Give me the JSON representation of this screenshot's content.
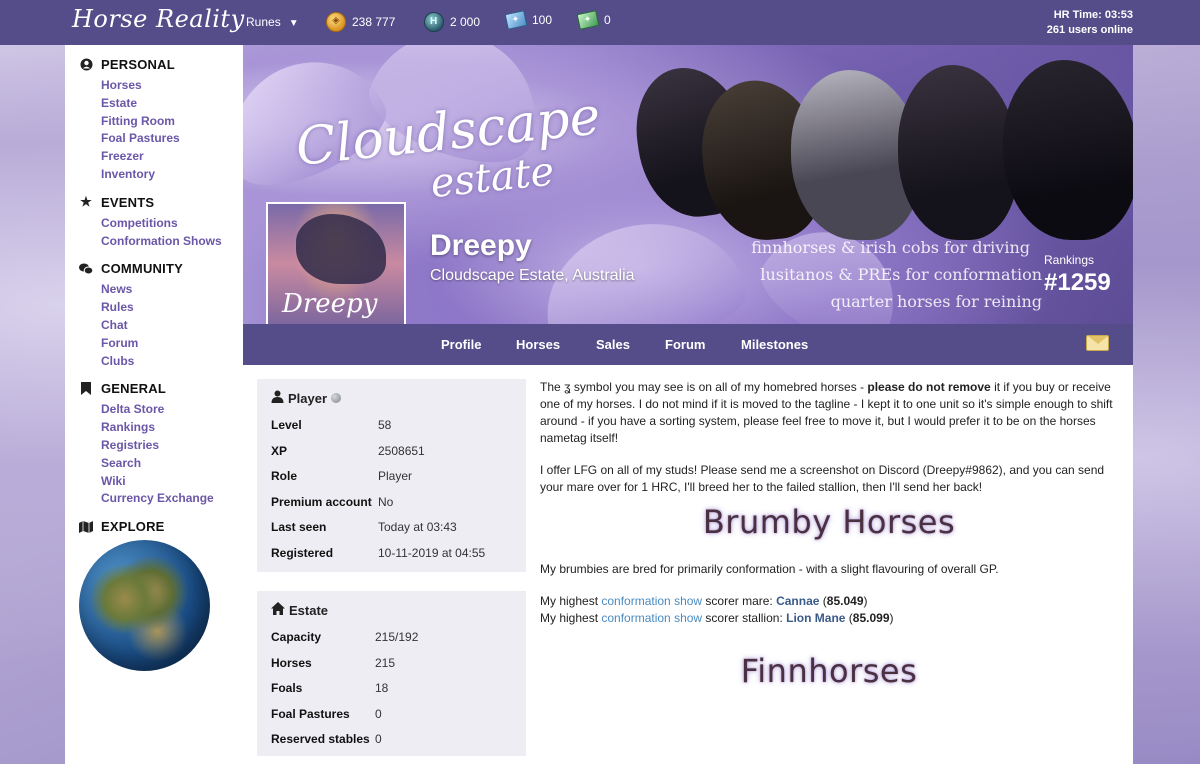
{
  "topbar": {
    "logo": "Horse Reality",
    "runes_label": "Runes",
    "currencies": [
      {
        "icon": "gold-coin-icon",
        "value": "238 777"
      },
      {
        "icon": "horse-coin-icon",
        "value": "2 000"
      },
      {
        "icon": "blue-ticket-icon",
        "value": "100"
      },
      {
        "icon": "green-ticket-icon",
        "value": "0"
      }
    ],
    "hr_time": "HR Time: 03:53",
    "users_online": "261 users online"
  },
  "sidebar": {
    "sections": [
      {
        "title": "PERSONAL",
        "icon": "user-circle-icon",
        "items": [
          "Horses",
          "Estate",
          "Fitting Room",
          "Foal Pastures",
          "Freezer",
          "Inventory"
        ]
      },
      {
        "title": "EVENTS",
        "icon": "star-icon",
        "items": [
          "Competitions",
          "Conformation Shows"
        ]
      },
      {
        "title": "COMMUNITY",
        "icon": "chat-icon",
        "items": [
          "News",
          "Rules",
          "Chat",
          "Forum",
          "Clubs"
        ]
      },
      {
        "title": "GENERAL",
        "icon": "bookmark-icon",
        "items": [
          "Delta Store",
          "Rankings",
          "Registries",
          "Search",
          "Wiki",
          "Currency Exchange"
        ]
      },
      {
        "title": "EXPLORE",
        "icon": "map-icon",
        "items": []
      }
    ]
  },
  "banner": {
    "estate_title_line1": "Cloudscape",
    "estate_title_line2": "estate",
    "avatar_signature": "Dreepy",
    "username": "Dreepy",
    "location": "Cloudscape Estate, Australia",
    "tagline": [
      "finnhorses & irish cobs for driving",
      "lusitanos & PREs for conformation",
      "quarter horses for reining"
    ],
    "rankings_label": "Rankings",
    "rankings_value": "#1259"
  },
  "nav": {
    "tabs": [
      "Profile",
      "Horses",
      "Sales",
      "Forum",
      "Milestones"
    ]
  },
  "player": {
    "title": "Player",
    "rows": [
      {
        "k": "Level",
        "v": "58"
      },
      {
        "k": "XP",
        "v": "2508651"
      },
      {
        "k": "Role",
        "v": "Player"
      },
      {
        "k": "Premium account",
        "v": "No"
      },
      {
        "k": "Last seen",
        "v": "Today at 03:43"
      },
      {
        "k": "Registered",
        "v": "10-11-2019 at 04:55"
      }
    ]
  },
  "estate": {
    "title": "Estate",
    "rows": [
      {
        "k": "Capacity",
        "v": "215/192"
      },
      {
        "k": "Horses",
        "v": "215"
      },
      {
        "k": "Foals",
        "v": "18"
      },
      {
        "k": "Foal Pastures",
        "v": "0"
      },
      {
        "k": "Reserved stables",
        "v": "0"
      }
    ]
  },
  "content": {
    "p1_a": "The ",
    "p1_symbol": "ʓ",
    "p1_b": " symbol you may see is on all of my homebred horses - ",
    "p1_bold": "please do not remove",
    "p1_c": " it if you buy or receive one of my horses. I do not mind if it is moved to the tagline - I kept it to one unit so it's simple enough to shift around - if you have a sorting system, please feel free to move it, but I would prefer it to be on the horses nametag itself!",
    "p2": "I offer LFG on all of my studs! Please send me a screenshot on Discord (Dreepy#9862), and you can send your mare over for 1 HRC, I'll breed her to the failed stallion, then I'll send her back!",
    "heading1": "Brumby Horses",
    "p3": "My brumbies are bred for primarily conformation - with a slight flavouring of overall GP.",
    "mare_pre": "My highest ",
    "show_link": "conformation show",
    "mare_mid": " scorer mare: ",
    "mare_name": "Cannae",
    "mare_score": "85.049",
    "stallion_mid": " scorer stallion: ",
    "stallion_name": "Lion Mane",
    "stallion_score": "85.099",
    "heading2": "Finnhorses"
  }
}
